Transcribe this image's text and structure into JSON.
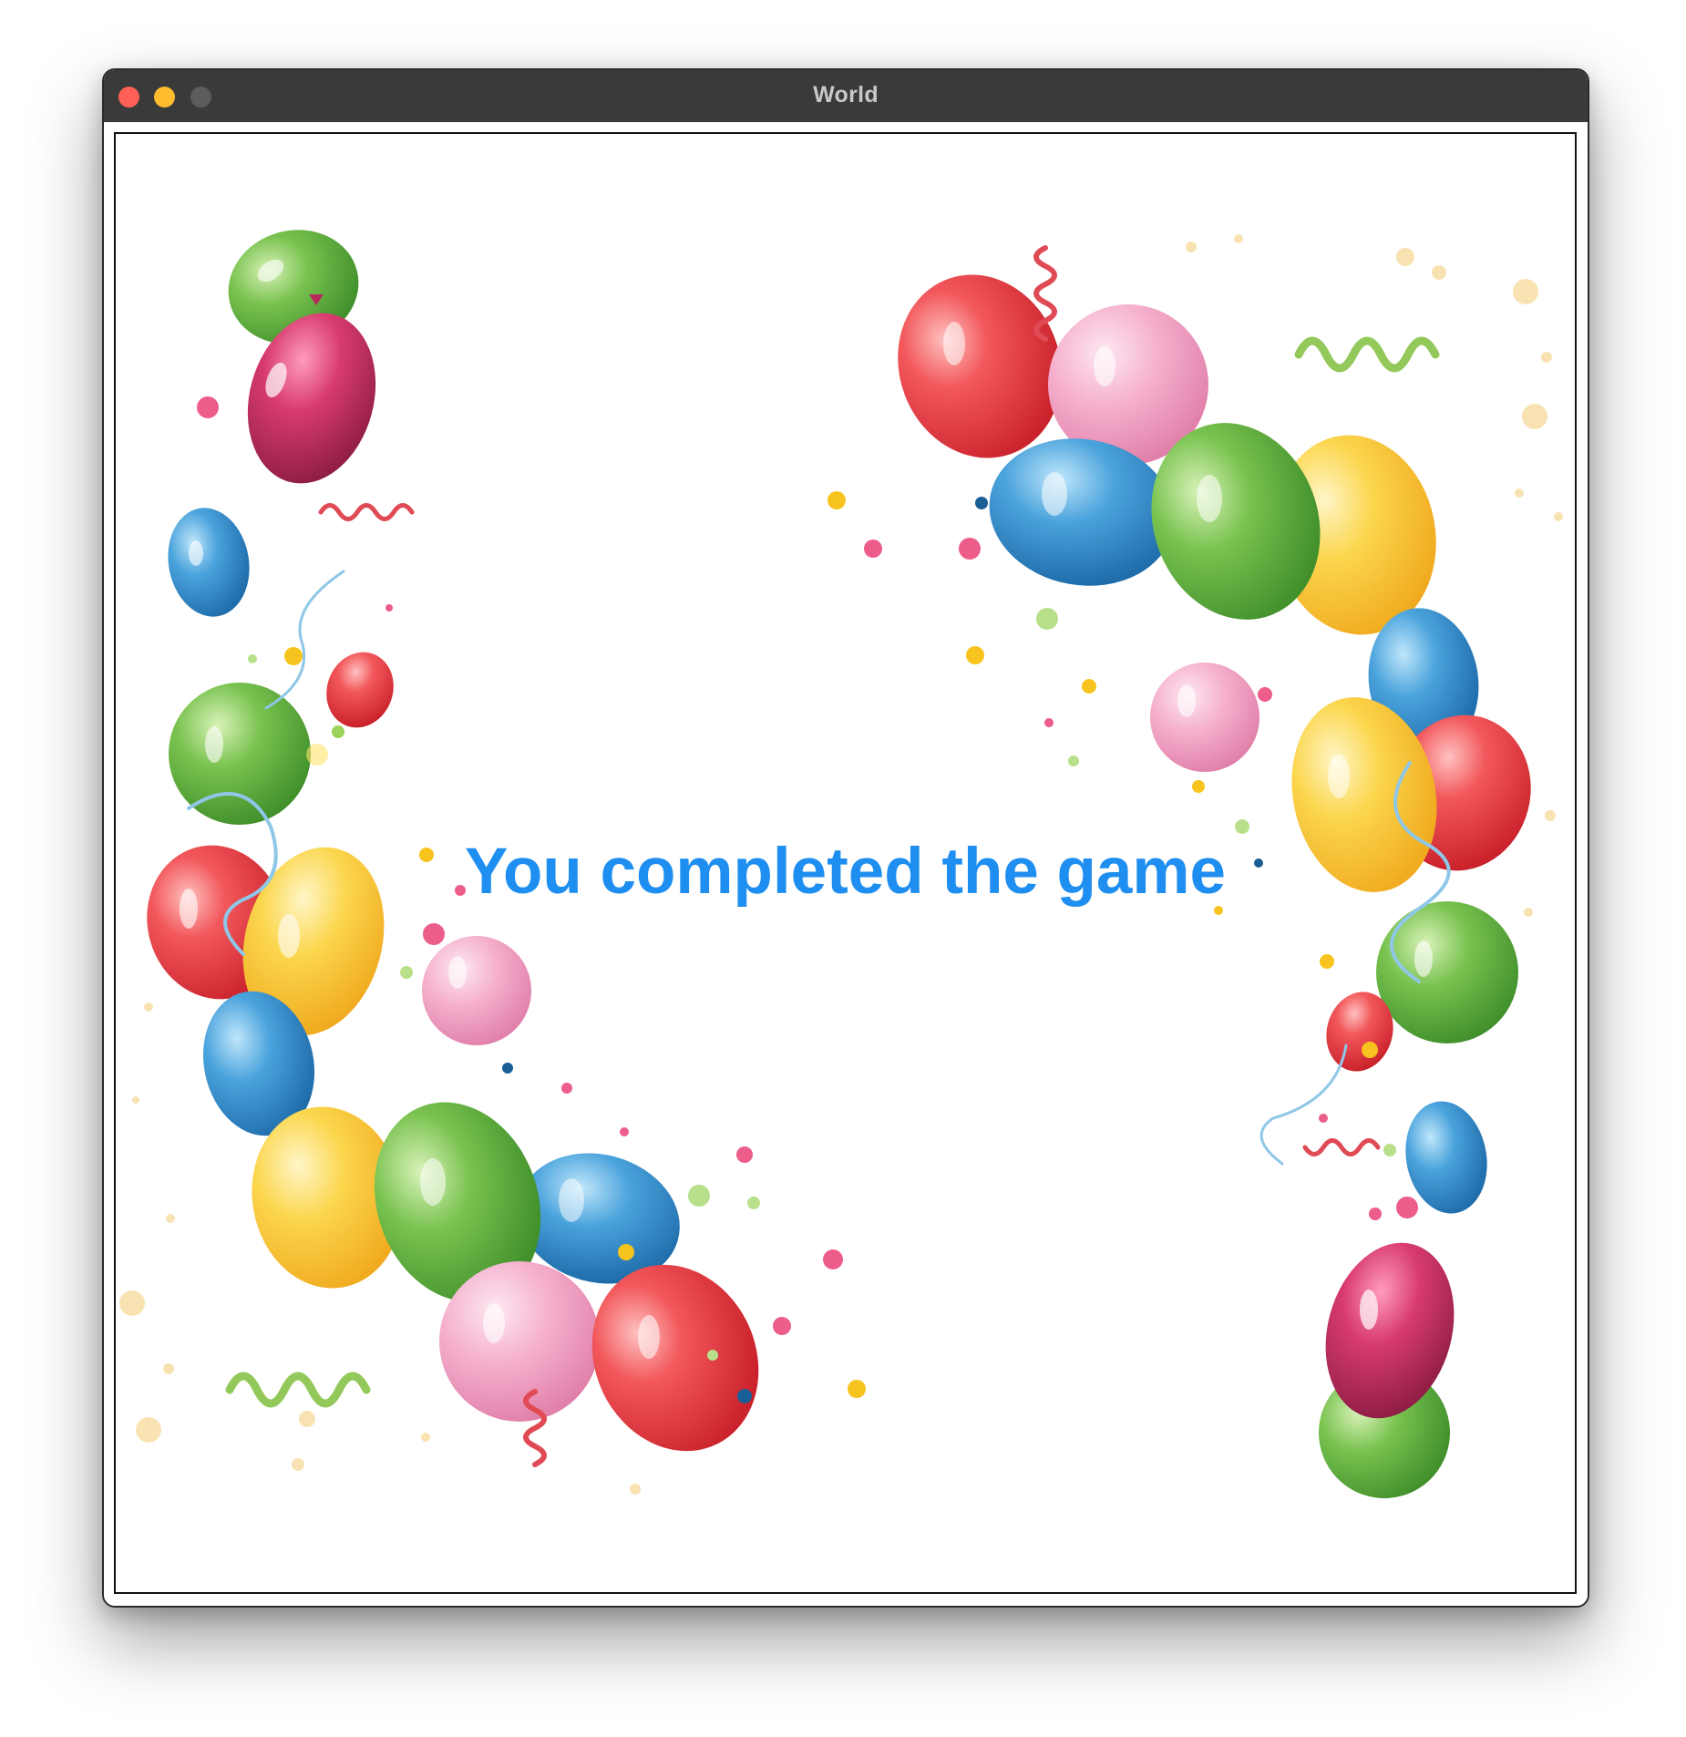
{
  "window": {
    "title": "World",
    "buttons": {
      "close": "close-button",
      "minimize": "minimize-button",
      "zoom": "zoom-button"
    }
  },
  "game": {
    "message": "You completed the game",
    "message_color": "#1e8ef0",
    "background": "Balloons, confetti and streamers celebration illustration"
  },
  "colors": {
    "balloon_red": "#e8353a",
    "balloon_green": "#5fae3e",
    "balloon_blue": "#2e86c8",
    "balloon_yellow": "#f6c22d",
    "balloon_pink": "#f19cc1",
    "balloon_magenta": "#b72a5a",
    "titlebar": "#3a3a3a"
  }
}
